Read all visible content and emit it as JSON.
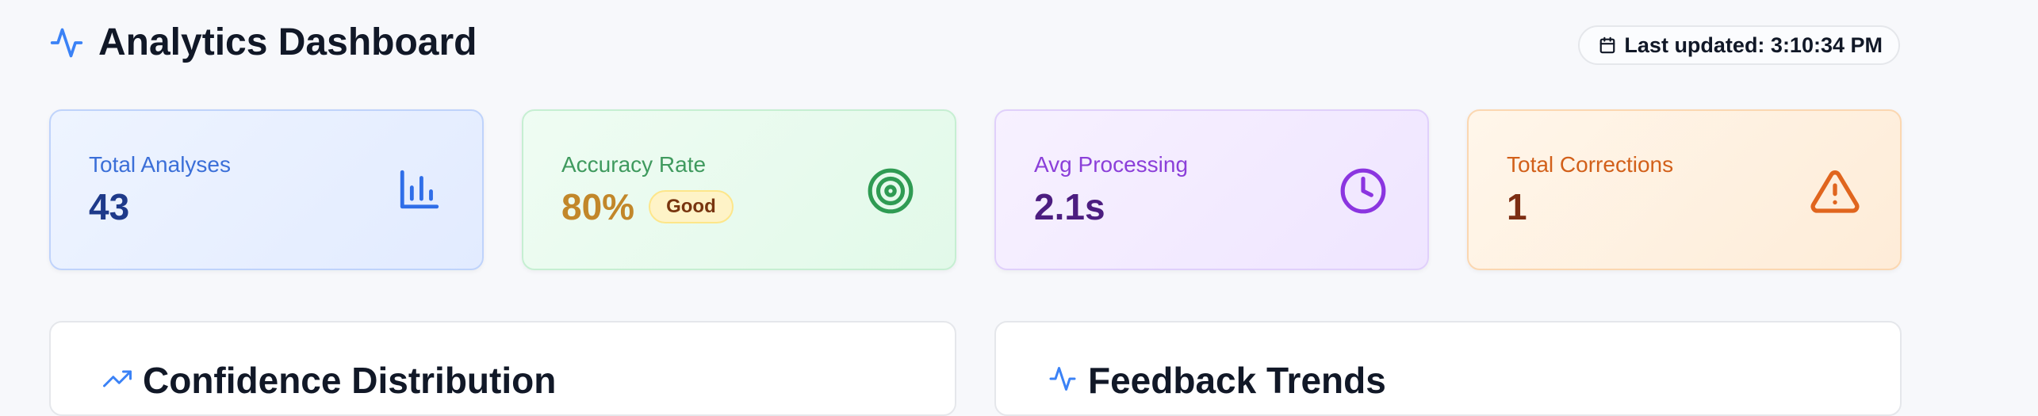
{
  "header": {
    "title": "Analytics Dashboard",
    "last_updated": "Last updated: 3:10:34 PM",
    "icon": "activity-icon"
  },
  "cards": [
    {
      "label": "Total Analyses",
      "value": "43",
      "icon": "bar-chart-icon",
      "label_color": "#3b6fd8",
      "value_color": "#1e3a8a",
      "icon_color": "#2f6ee8"
    },
    {
      "label": "Accuracy Rate",
      "value": "80%",
      "badge": "Good",
      "icon": "target-icon",
      "label_color": "#3f9a5e",
      "value_color": "#c2872a",
      "icon_color": "#2f9b53"
    },
    {
      "label": "Avg Processing",
      "value": "2.1s",
      "icon": "clock-icon",
      "label_color": "#8b3fd9",
      "value_color": "#4c1d80",
      "icon_color": "#8b35e0"
    },
    {
      "label": "Total Corrections",
      "value": "1",
      "icon": "warning-icon",
      "label_color": "#d2601a",
      "value_color": "#7c2d12",
      "icon_color": "#e0651e"
    }
  ],
  "panels": [
    {
      "title": "Confidence Distribution",
      "icon": "trend-icon"
    },
    {
      "title": "Feedback Trends",
      "icon": "activity-icon"
    }
  ]
}
